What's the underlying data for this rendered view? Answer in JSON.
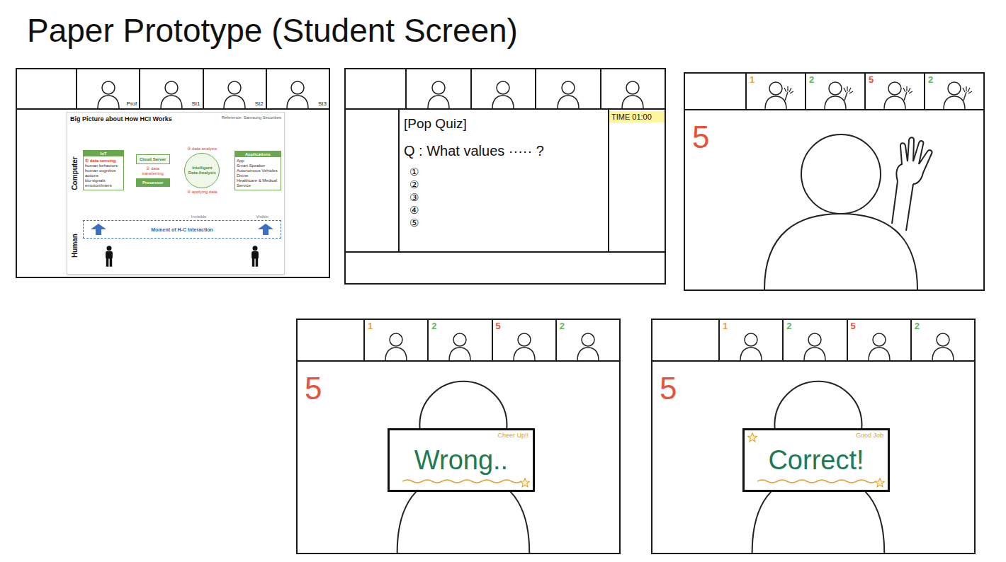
{
  "title": "Paper Prototype (Student Screen)",
  "frames": [
    {
      "kind": "lecture",
      "participants": [
        {
          "label": "Prof",
          "waving": false
        },
        {
          "label": "St1",
          "waving": false
        },
        {
          "label": "St2",
          "waving": false
        },
        {
          "label": "St3",
          "waving": false
        }
      ],
      "slide": {
        "title": "Big Picture about How HCI Works",
        "reference": "Reference: Samsung Securities",
        "computer_label": "Computer",
        "human_label": "Human",
        "sensing": {
          "header": "IoT",
          "step": "① data sensing",
          "items": [
            "human behaviors",
            "human cognitive actions",
            "bio-signals",
            "emotion/intent"
          ]
        },
        "cloud": "Cloud Server",
        "step2": "② data transferring",
        "processor": "Processor",
        "step3": "③ data analysis",
        "analysis": "Intelligent Data Analysis",
        "step4": "④ applying data",
        "applications": {
          "header": "Applications",
          "items": [
            "App",
            "Smart Speaker",
            "Autonomous Vehicles",
            "Drone",
            "Healthcare & Medical Service"
          ]
        },
        "invisible": "Invisible",
        "visible": "Visible",
        "interaction": "Moment of H-C Interaction"
      }
    },
    {
      "kind": "quiz",
      "participants": [
        {
          "waving": false
        },
        {
          "waving": false
        },
        {
          "waving": false
        },
        {
          "waving": false
        }
      ],
      "quiz": {
        "heading": "[Pop Quiz]",
        "question": "Q : What values ····· ?",
        "options": [
          "①",
          "②",
          "③",
          "④",
          "⑤"
        ],
        "timer": "TIME 01:00"
      }
    },
    {
      "kind": "raise",
      "participants": [
        {
          "score": "1",
          "color": "#e8a23a",
          "waving": true
        },
        {
          "score": "2",
          "color": "#5cb85c",
          "waving": true
        },
        {
          "score": "5",
          "color": "#e5533d",
          "waving": true
        },
        {
          "score": "2",
          "color": "#5cb85c",
          "waving": true
        }
      ],
      "score": "5",
      "color": "#e5533d",
      "waving": true
    },
    {
      "kind": "result",
      "participants": [
        {
          "score": "1",
          "color": "#e8a23a",
          "waving": false
        },
        {
          "score": "2",
          "color": "#5cb85c",
          "waving": false
        },
        {
          "score": "5",
          "color": "#e5533d",
          "waving": false
        },
        {
          "score": "2",
          "color": "#5cb85c",
          "waving": false
        }
      ],
      "score": "5",
      "color": "#e5533d",
      "sign": {
        "text": "Wrong..",
        "note": "Cheer Up!!",
        "correct": false
      }
    },
    {
      "kind": "result",
      "participants": [
        {
          "score": "1",
          "color": "#e8a23a",
          "waving": false
        },
        {
          "score": "2",
          "color": "#5cb85c",
          "waving": false
        },
        {
          "score": "5",
          "color": "#e5533d",
          "waving": false
        },
        {
          "score": "2",
          "color": "#5cb85c",
          "waving": false
        }
      ],
      "score": "5",
      "color": "#e5533d",
      "sign": {
        "text": "Correct!",
        "note": "Good Job",
        "correct": true
      }
    }
  ]
}
